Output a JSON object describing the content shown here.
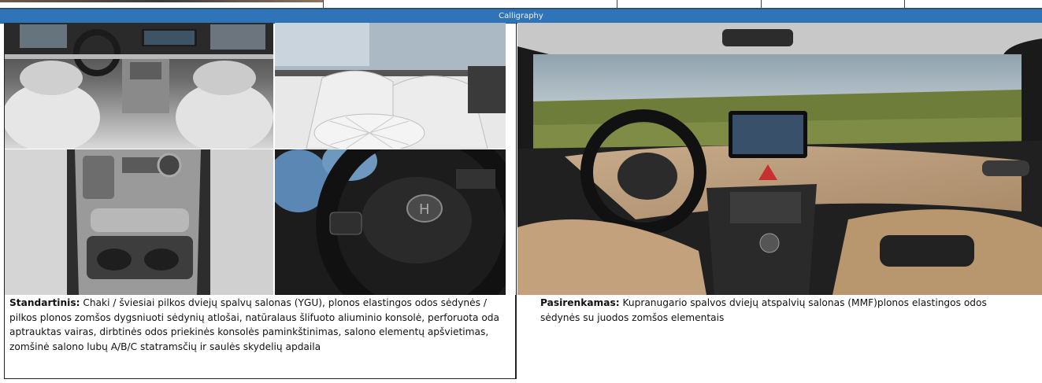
{
  "section_title": "Calligraphy",
  "photos": {
    "front_cabin": "front-cabin-photo",
    "rear_seats": "rear-seats-photo",
    "center_console": "center-console-photo",
    "steering_wheel": "steering-wheel-photo",
    "dashboard_beige": "dashboard-beige-photo"
  },
  "standard": {
    "label": "Standartinis:",
    "text": " Chaki / šviesiai pilkos dviejų spalvų salonas (YGU), plonos elastingos odos sėdynės / pilkos plonos zomšos dygsniuoti sėdynių atlošai, natūralaus šlifuoto aliuminio konsolė, perforuota oda aptrauktas vairas, dirbtinės odos priekinės konsolės paminkštinimas, salono elementų apšvietimas, zomšinė salono lubų A/B/C statramsčių ir saulės skydelių apdaila"
  },
  "optional": {
    "label": "Pasirenkamas:",
    "text": " Kupranugario spalvos dviejų atspalvių salonas (MMF)plonos elastingos odos sėdynės su juodos zomšos elementais"
  }
}
